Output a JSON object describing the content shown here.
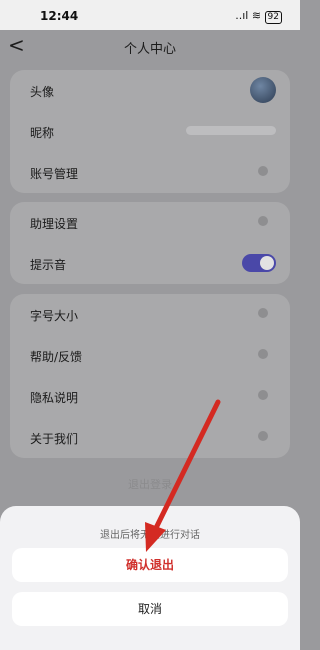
{
  "status_bar": {
    "time": "12:44",
    "signal": "..ıl ≋",
    "battery": "92"
  },
  "header": {
    "title": "个人中心",
    "back": "<"
  },
  "profile": {
    "rows": [
      {
        "label": "头像"
      },
      {
        "label": "昵称"
      },
      {
        "label": "账号管理"
      }
    ]
  },
  "assistant": {
    "rows": [
      {
        "label": "助理设置"
      },
      {
        "label": "提示音",
        "toggle_on": true
      }
    ]
  },
  "general": {
    "rows": [
      {
        "label": "字号大小"
      },
      {
        "label": "帮助/反馈"
      },
      {
        "label": "隐私说明"
      },
      {
        "label": "关于我们"
      }
    ]
  },
  "logout_ghost": "退出登录",
  "sheet": {
    "notice": "退出后将无法进行对话",
    "confirm_label": "确认退出",
    "cancel_label": "取消"
  },
  "annotation_arrow_color": "#d42a22"
}
